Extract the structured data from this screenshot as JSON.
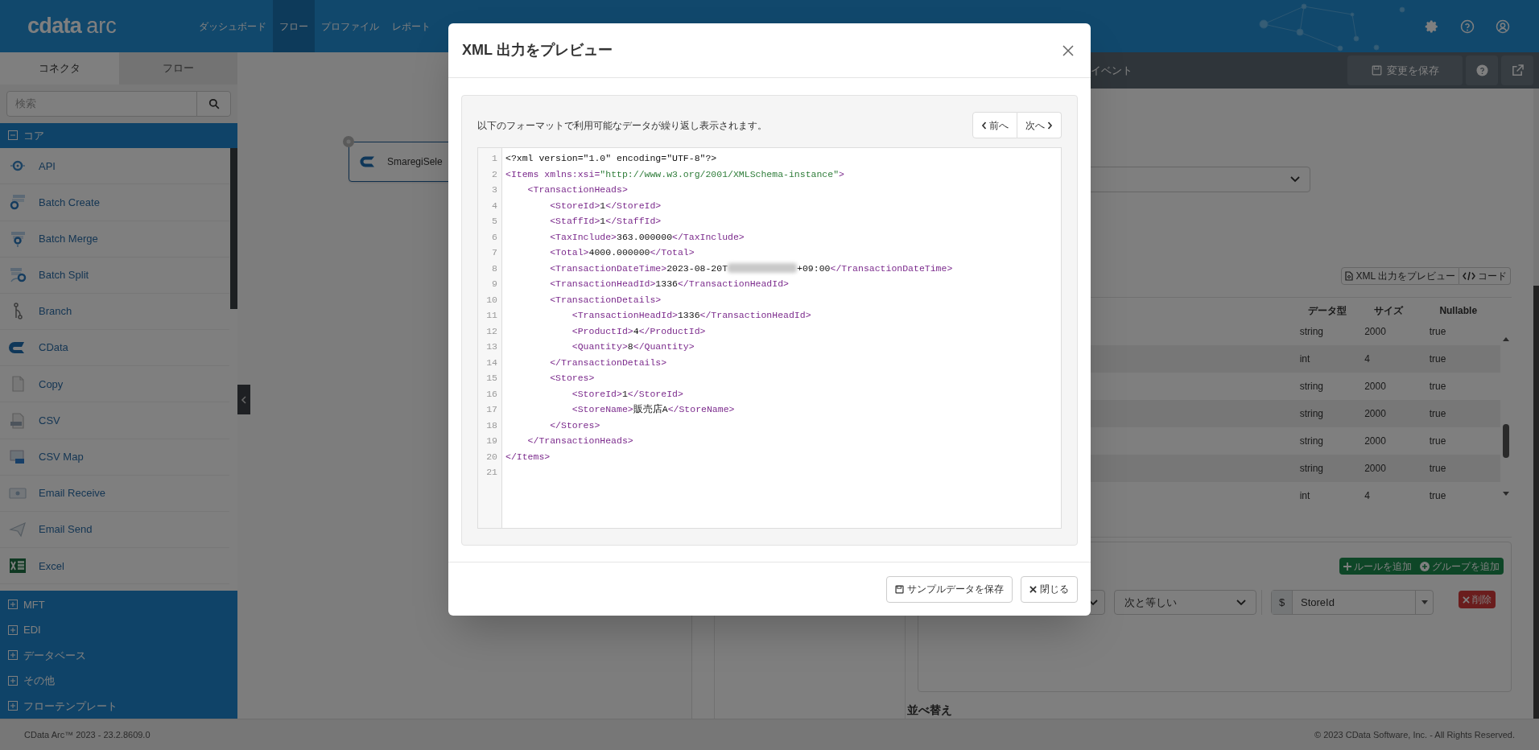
{
  "topbar": {
    "logo": {
      "brand": "cdata",
      "product": "arc"
    },
    "nav": [
      {
        "label": "ダッシュボード",
        "selected": false
      },
      {
        "label": "フロー",
        "selected": true
      },
      {
        "label": "プロファイル",
        "selected": false
      },
      {
        "label": "レポート",
        "selected": false
      }
    ]
  },
  "sidebar": {
    "tabs": [
      {
        "label": "コネクタ",
        "selected": true
      },
      {
        "label": "フロー",
        "selected": false
      }
    ],
    "search": {
      "placeholder": "検索"
    },
    "sections": [
      {
        "label": "コア",
        "expanded": true,
        "items": [
          "API",
          "Batch Create",
          "Batch Merge",
          "Batch Split",
          "Branch",
          "CData",
          "Copy",
          "CSV",
          "CSV Map",
          "Email Receive",
          "Email Send",
          "Excel"
        ]
      },
      {
        "label": "MFT",
        "expanded": false
      },
      {
        "label": "EDI",
        "expanded": false
      },
      {
        "label": "データベース",
        "expanded": false
      },
      {
        "label": "その他",
        "expanded": false
      },
      {
        "label": "フローテンプレート",
        "expanded": false
      }
    ]
  },
  "canvas": {
    "node": {
      "label": "SmaregiSele"
    }
  },
  "panel": {
    "event_tab": "イベント",
    "save_button": "変更を保存",
    "preview_button": "XML 出力をプレビュー",
    "code_button": "コード",
    "table": {
      "columns": [
        "データ型",
        "サイズ",
        "Nullable"
      ],
      "rows": [
        {
          "data_type": "string",
          "size": "2000",
          "nullable": "true"
        },
        {
          "data_type": "int",
          "size": "4",
          "nullable": "true"
        },
        {
          "data_type": "string",
          "size": "2000",
          "nullable": "true"
        },
        {
          "data_type": "string",
          "size": "2000",
          "nullable": "true"
        },
        {
          "data_type": "string",
          "size": "2000",
          "nullable": "true"
        },
        {
          "data_type": "string",
          "size": "2000",
          "nullable": "true"
        },
        {
          "data_type": "int",
          "size": "4",
          "nullable": "true"
        }
      ]
    },
    "rules": {
      "add_rule": "ルールを追加",
      "add_group": "グループを追加",
      "operator": "次と等しい",
      "prefix": "$",
      "value": "StoreId",
      "delete": "削除"
    },
    "sort_heading": "並べ替え"
  },
  "footer": {
    "version": "CData Arc™ 2023 - 23.2.8609.0",
    "copyright": "© 2023 CData Software, Inc. - All Rights Reserved."
  },
  "modal": {
    "title": "XML 出力をプレビュー",
    "description": "以下のフォーマットで利用可能なデータが繰り返し表示されます。",
    "prev": "前へ",
    "next": "次へ",
    "code_lines": [
      {
        "number": "1",
        "tokens": [
          {
            "kind": "plain",
            "text": "<?xml version=\"1.0\" encoding=\"UTF-8\"?>"
          }
        ]
      },
      {
        "number": "2",
        "tokens": [
          {
            "kind": "tag",
            "text": "<Items xmlns:xsi="
          },
          {
            "kind": "string",
            "text": "\"http://www.w3.org/2001/XMLSchema-instance\""
          },
          {
            "kind": "tag",
            "text": ">"
          }
        ]
      },
      {
        "number": "3",
        "tokens": [
          {
            "kind": "tag",
            "text": "    <TransactionHeads>"
          }
        ]
      },
      {
        "number": "4",
        "tokens": [
          {
            "kind": "tag",
            "text": "        <StoreId>"
          },
          {
            "kind": "plain",
            "text": "1"
          },
          {
            "kind": "tag",
            "text": "</StoreId>"
          }
        ]
      },
      {
        "number": "5",
        "tokens": [
          {
            "kind": "tag",
            "text": "        <StaffId>"
          },
          {
            "kind": "plain",
            "text": "1"
          },
          {
            "kind": "tag",
            "text": "</StaffId>"
          }
        ]
      },
      {
        "number": "6",
        "tokens": [
          {
            "kind": "tag",
            "text": "        <TaxInclude>"
          },
          {
            "kind": "plain",
            "text": "363.000000"
          },
          {
            "kind": "tag",
            "text": "</TaxInclude>"
          }
        ]
      },
      {
        "number": "7",
        "tokens": [
          {
            "kind": "tag",
            "text": "        <Total>"
          },
          {
            "kind": "plain",
            "text": "4000.000000"
          },
          {
            "kind": "tag",
            "text": "</Total>"
          }
        ]
      },
      {
        "number": "8",
        "tokens": [
          {
            "kind": "tag",
            "text": "        <TransactionDateTime>"
          },
          {
            "kind": "plain",
            "text": "2023-08-20T"
          },
          {
            "kind": "redacted"
          },
          {
            "kind": "plain",
            "text": "+09:00"
          },
          {
            "kind": "tag",
            "text": "</TransactionDateTime>"
          }
        ]
      },
      {
        "number": "9",
        "tokens": [
          {
            "kind": "tag",
            "text": "        <TransactionHeadId>"
          },
          {
            "kind": "plain",
            "text": "1336"
          },
          {
            "kind": "tag",
            "text": "</TransactionHeadId>"
          }
        ]
      },
      {
        "number": "10",
        "tokens": [
          {
            "kind": "tag",
            "text": "        <TransactionDetails>"
          }
        ]
      },
      {
        "number": "11",
        "tokens": [
          {
            "kind": "tag",
            "text": "            <TransactionHeadId>"
          },
          {
            "kind": "plain",
            "text": "1336"
          },
          {
            "kind": "tag",
            "text": "</TransactionHeadId>"
          }
        ]
      },
      {
        "number": "12",
        "tokens": [
          {
            "kind": "tag",
            "text": "            <ProductId>"
          },
          {
            "kind": "plain",
            "text": "4"
          },
          {
            "kind": "tag",
            "text": "</ProductId>"
          }
        ]
      },
      {
        "number": "13",
        "tokens": [
          {
            "kind": "tag",
            "text": "            <Quantity>"
          },
          {
            "kind": "plain",
            "text": "8"
          },
          {
            "kind": "tag",
            "text": "</Quantity>"
          }
        ]
      },
      {
        "number": "14",
        "tokens": [
          {
            "kind": "tag",
            "text": "        </TransactionDetails>"
          }
        ]
      },
      {
        "number": "15",
        "tokens": [
          {
            "kind": "tag",
            "text": "        <Stores>"
          }
        ]
      },
      {
        "number": "16",
        "tokens": [
          {
            "kind": "tag",
            "text": "            <StoreId>"
          },
          {
            "kind": "plain",
            "text": "1"
          },
          {
            "kind": "tag",
            "text": "</StoreId>"
          }
        ]
      },
      {
        "number": "17",
        "tokens": [
          {
            "kind": "tag",
            "text": "            <StoreName>"
          },
          {
            "kind": "plain",
            "text": "販売店A"
          },
          {
            "kind": "tag",
            "text": "</StoreName>"
          }
        ]
      },
      {
        "number": "18",
        "tokens": [
          {
            "kind": "tag",
            "text": "        </Stores>"
          }
        ]
      },
      {
        "number": "19",
        "tokens": [
          {
            "kind": "tag",
            "text": "    </TransactionHeads>"
          }
        ]
      },
      {
        "number": "20",
        "tokens": [
          {
            "kind": "tag",
            "text": "</Items>"
          }
        ]
      },
      {
        "number": "21"
      }
    ],
    "buttons": [
      {
        "label": "サンプルデータを保存",
        "kind": "save"
      },
      {
        "label": "閉じる",
        "kind": "close"
      }
    ]
  }
}
